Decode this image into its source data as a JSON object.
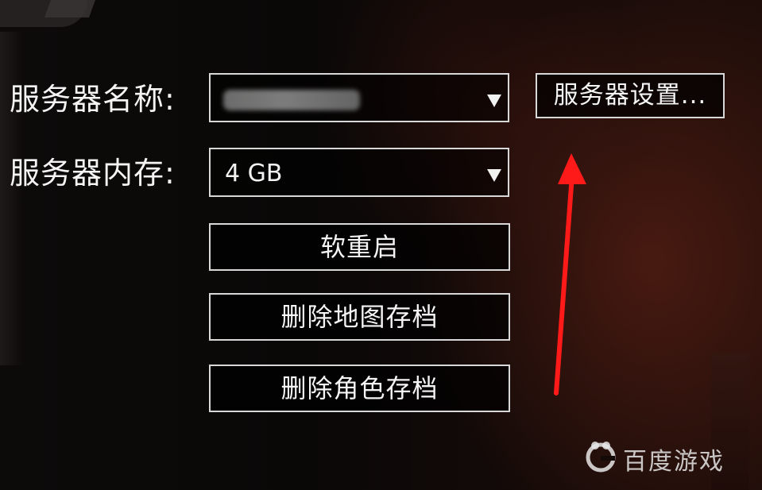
{
  "form": {
    "server_name_label": "服务器名称:",
    "server_memory_label": "服务器内存:",
    "server_name_value": "",
    "server_memory_value": "4 GB"
  },
  "buttons": {
    "server_settings": "服务器设置...",
    "soft_restart": "软重启",
    "delete_map_save": "删除地图存档",
    "delete_character_save": "删除角色存档"
  },
  "annotation": {
    "arrow_color": "#ff1a1a"
  },
  "watermark": {
    "icon": "baidu-game-logo-icon",
    "text": "百度游戏"
  },
  "colors": {
    "border": "#d8d8d8",
    "text": "#f4f4f4",
    "background_dark": "#0a0807",
    "background_red_glow": "#6e2618"
  }
}
